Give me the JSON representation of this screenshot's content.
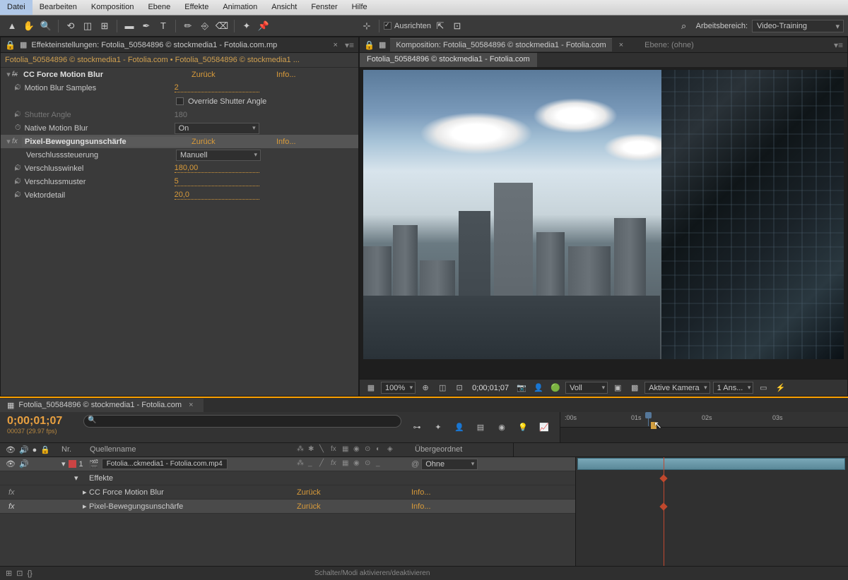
{
  "menu": [
    "Datei",
    "Bearbeiten",
    "Komposition",
    "Ebene",
    "Effekte",
    "Animation",
    "Ansicht",
    "Fenster",
    "Hilfe"
  ],
  "toolbar": {
    "align": "Ausrichten",
    "wslabel": "Arbeitsbereich:",
    "wsvalue": "Video-Training"
  },
  "effectsPanel": {
    "title": "Effekteinstellungen: Fotolia_50584896 © stockmedia1 - Fotolia.com.mp",
    "breadcrumb": "Fotolia_50584896 © stockmedia1 - Fotolia.com • Fotolia_50584896 © stockmedia1 ...",
    "reset": "Zurück",
    "info": "Info...",
    "fx1": {
      "name": "CC Force Motion Blur",
      "p1": "Motion Blur Samples",
      "v1": "2",
      "p2": "Override Shutter Angle",
      "p3": "Shutter Angle",
      "v3": "180",
      "p4": "Native Motion Blur",
      "v4": "On"
    },
    "fx2": {
      "name": "Pixel-Bewegungsunschärfe",
      "p1": "Verschlusssteuerung",
      "v1": "Manuell",
      "p2": "Verschlusswinkel",
      "v2": "180,00",
      "p3": "Verschlussmuster",
      "v3": "5",
      "p4": "Vektordetail",
      "v4": "20,0"
    }
  },
  "compPanel": {
    "title": "Komposition: Fotolia_50584896 © stockmedia1 - Fotolia.com",
    "layerTitle": "Ebene: (ohne)",
    "tab": "Fotolia_50584896 © stockmedia1 - Fotolia.com"
  },
  "viewer": {
    "zoom": "100%",
    "time": "0;00;01;07",
    "res": "Voll",
    "cam": "Aktive Kamera",
    "views": "1 Ans..."
  },
  "timeline": {
    "tab": "Fotolia_50584896 © stockmedia1 - Fotolia.com",
    "tc": "0;00;01;07",
    "frames": "00037 (29.97 fps)",
    "colNr": "Nr.",
    "colSrc": "Quellenname",
    "colPar": "Übergeordnet",
    "layer1": {
      "nr": "1",
      "name": "Fotolia...ckmedia1 - Fotolia.com.mp4",
      "parent": "Ohne"
    },
    "fxLabel": "Effekte",
    "fx1": "CC Force Motion Blur",
    "fx2": "Pixel-Bewegungsunschärfe",
    "reset": "Zurück",
    "info": "Info...",
    "secs": [
      ":00s",
      "01s",
      "02s",
      "03s"
    ],
    "toggle": "Schalter/Modi aktivieren/deaktivieren"
  }
}
